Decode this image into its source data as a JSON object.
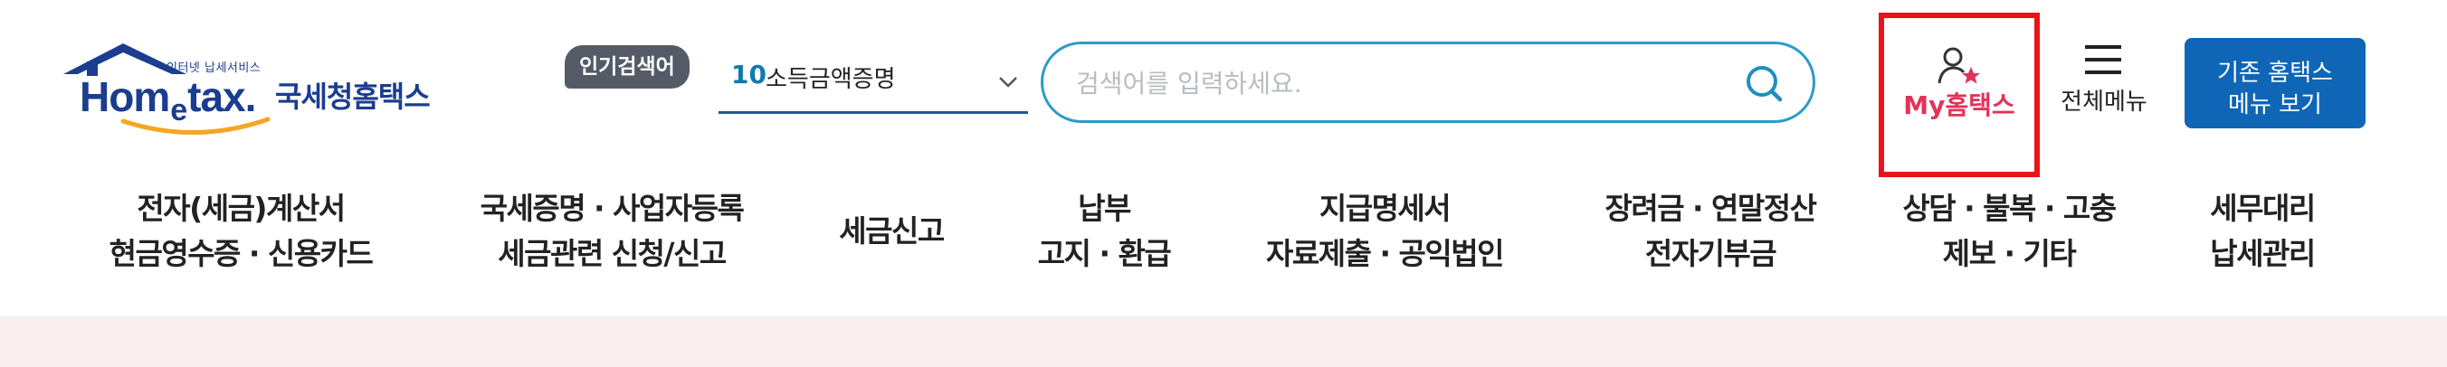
{
  "logo": {
    "tagline": "인터넷 납세서비스",
    "word_main_1": "Hom",
    "word_e": "e",
    "word_main_2": "tax.",
    "subtitle": "국세청홈택스",
    "brand_color": "#1a3d8f",
    "accent_color": "#f5a623"
  },
  "search": {
    "popular_badge": "인기검색어",
    "popular_rank": "10",
    "popular_term": "소득금액증명",
    "placeholder": "검색어를 입력하세요.",
    "accent_color": "#2a9cc9"
  },
  "utility": {
    "my_hometax_label": "My홈택스",
    "all_menu_label": "전체메뉴",
    "legacy_line1": "기존 홈택스",
    "legacy_line2": "메뉴 보기",
    "highlight_color": "#e8141a"
  },
  "nav": [
    {
      "line1": "전자(세금)계산서",
      "line2": "현금영수증 · 신용카드"
    },
    {
      "line1": "국세증명 · 사업자등록",
      "line2": "세금관련 신청/신고"
    },
    {
      "line1": "세금신고",
      "line2": ""
    },
    {
      "line1": "납부",
      "line2": "고지 · 환급"
    },
    {
      "line1": "지급명세서",
      "line2": "자료제출 · 공익법인"
    },
    {
      "line1": "장려금 · 연말정산",
      "line2": "전자기부금"
    },
    {
      "line1": "상담 · 불복 · 고충",
      "line2": "제보 · 기타"
    },
    {
      "line1": "세무대리",
      "line2": "납세관리"
    }
  ]
}
